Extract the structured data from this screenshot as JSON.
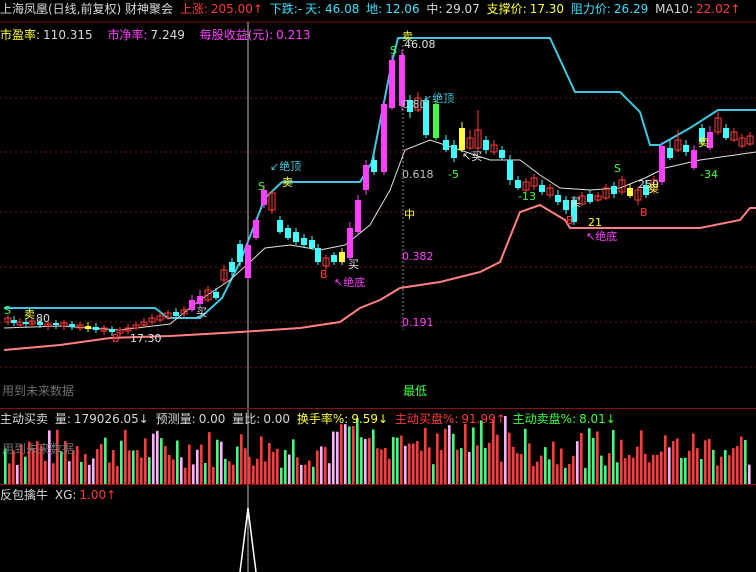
{
  "header": {
    "title": "上海凤凰(日线,前复权) 财神聚会",
    "items": [
      {
        "label": "上涨:",
        "value": "205.00↑",
        "color": "r"
      },
      {
        "label": "下跌:-",
        "value": "天: 46.08",
        "color": "c"
      },
      {
        "label": "地:",
        "value": "12.06",
        "color": "c"
      },
      {
        "label": "中:",
        "value": "29.07",
        "color": "w"
      },
      {
        "label": "支撑价:",
        "value": "17.30",
        "color": "y"
      },
      {
        "label": "阻力价:",
        "value": "26.29",
        "color": "c"
      },
      {
        "label": "MA10:",
        "value": "22.02↑",
        "color": "w"
      }
    ]
  },
  "valuation": {
    "pe_label": "市盈率:",
    "pe": "110.315",
    "pb_label": "市净率:",
    "pb": "7.249",
    "eps_label": "每股收益(元):",
    "eps": "0.213"
  },
  "main_chart": {
    "annotations": {
      "top_price": "46.08",
      "sell_top": "卖",
      "peak_label": "绝顶",
      "fib_0_80": "0.80",
      "fib_618": "0.618",
      "fib_mid": "中",
      "fib_382": "0.382",
      "fib_191": "0.191",
      "neg5": "-5",
      "neg13": "-13",
      "neg21": "21",
      "neg34": "-34",
      "n250": "250",
      "buy": "买",
      "sell": "卖",
      "bottom": "绝底",
      "s_mark": "S",
      "b_mark": "B",
      "start_label": "80",
      "low_price": "17.30"
    },
    "watermark": "用到未来数据",
    "bottom_label": "最低"
  },
  "volume_panel": {
    "title": "主动买卖",
    "vol_label": "量:",
    "vol": "179026.05↓",
    "forecast_label": "预测量:",
    "forecast": "0.00",
    "ratio_label": "量比:",
    "ratio": "0.00",
    "turnover_label": "换手率%:",
    "turnover": "9.59↓",
    "buy_label": "主动买盘%:",
    "buy": "91.99↑",
    "sell_label": "主动卖盘%:",
    "sell": "8.01↓",
    "watermark": "用到未来数据"
  },
  "signal_panel": {
    "title": "反包擒牛",
    "xg_label": "XG:",
    "xg": "1.00↑"
  },
  "colors": {
    "up": "#ff3b3b",
    "down": "#40ffff",
    "magenta": "#ff40ff",
    "yellow": "#ffff40",
    "resist": "#3fc8e0",
    "support": "#ff8080",
    "ma": "#e0e0e0"
  }
}
